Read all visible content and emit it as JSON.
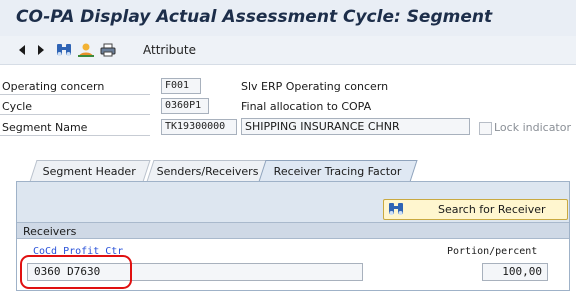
{
  "window": {
    "title": "CO-PA Display Actual Assessment Cycle: Segment"
  },
  "toolbar": {
    "icons": [
      "arrow-left-icon",
      "arrow-right-icon",
      "find-icon",
      "person-icon",
      "printer-icon"
    ],
    "attribute_label": "Attribute"
  },
  "fields": {
    "operating_concern": {
      "label": "Operating concern",
      "value": "F001",
      "desc": "Slv ERP Operating concern"
    },
    "cycle": {
      "label": "Cycle",
      "value": "0360P1",
      "desc": "Final allocation to COPA"
    },
    "segment_name": {
      "label": "Segment Name",
      "value": "TK19300000",
      "desc": "SHIPPING INSURANCE CHNR"
    },
    "lock_indicator": {
      "label": "Lock indicator",
      "checked": false
    }
  },
  "tabs": [
    {
      "label": "Segment Header",
      "active": false
    },
    {
      "label": "Senders/Receivers",
      "active": false
    },
    {
      "label": "Receiver Tracing Factor",
      "active": true
    }
  ],
  "search_button": {
    "label": "Search for Receiver",
    "icon": "binoculars-icon"
  },
  "receivers": {
    "header": "Receivers",
    "col_left": "CoCd Profit Ctr",
    "col_right": "Portion/percent",
    "row_value": "0360 D7630",
    "row_portion": "100,00"
  },
  "colors": {
    "title_text": "#1d2e4a",
    "highlight": "#e01010",
    "panel_bg": "#dde6f0",
    "button_bg": "#fff6cf",
    "link": "#2a52d9"
  }
}
